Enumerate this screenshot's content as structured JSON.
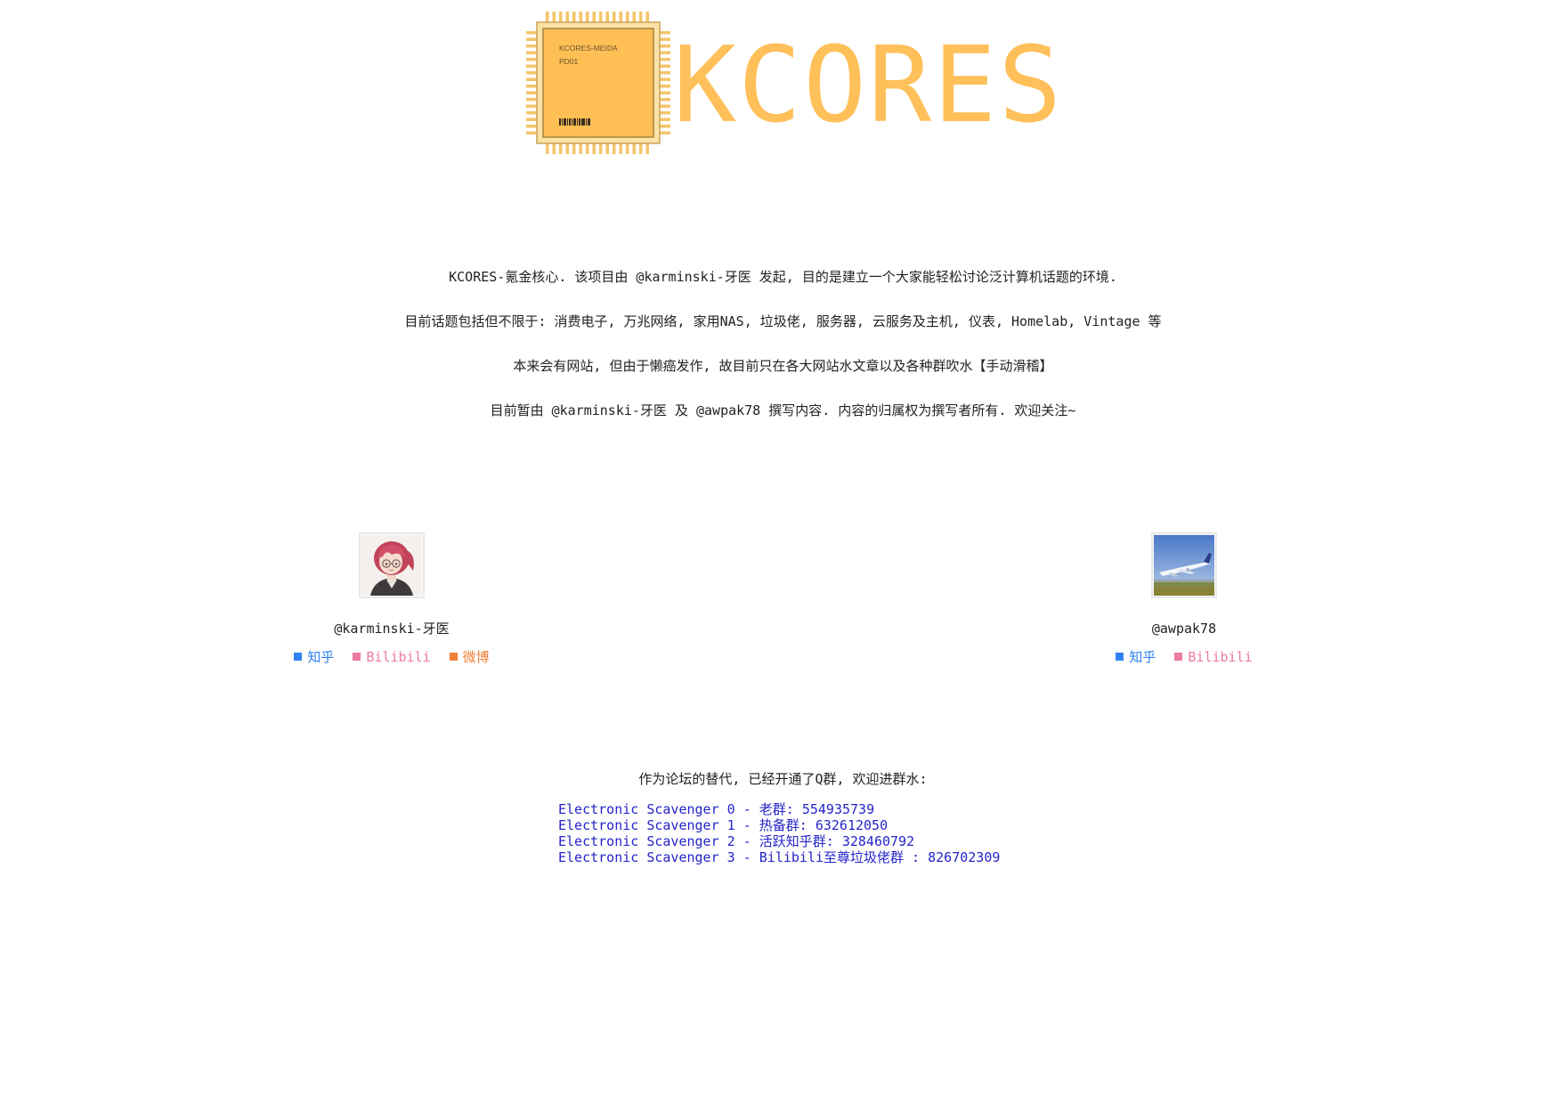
{
  "header": {
    "brand": "KCORES",
    "chip_line1": "KCORES-MEIDA",
    "chip_line2": "PD01",
    "colors": {
      "brand": "#ffc05a",
      "chip_body": "#ffbf55",
      "chip_border": "#a8843c"
    }
  },
  "intro": {
    "lines": [
      "KCORES-氪金核心. 该项目由 @karminski-牙医 发起, 目的是建立一个大家能轻松讨论泛计算机话题的环境.",
      "目前话题包括但不限于: 消费电子, 万兆网络, 家用NAS, 垃圾佬, 服务器, 云服务及主机, 仪表, Homelab, Vintage 等",
      "本来会有网站, 但由于懒癌发作, 故目前只在各大网站水文章以及各种群吹水【手动滑稽】",
      "目前暂由 @karminski-牙医 及 @awpak78 撰写内容. 内容的归属权为撰写者所有. 欢迎关注~"
    ]
  },
  "authors": [
    {
      "handle": "@karminski-牙医",
      "avatar_icon": "anime-girl-avatar",
      "links": [
        {
          "label": "知乎",
          "color": "#2f82f2"
        },
        {
          "label": "Bilibili",
          "color": "#ec7aa3"
        },
        {
          "label": "微博",
          "color": "#f08037"
        }
      ]
    },
    {
      "handle": "@awpak78",
      "avatar_icon": "airplane-avatar",
      "links": [
        {
          "label": "知乎",
          "color": "#2f82f2"
        },
        {
          "label": "Bilibili",
          "color": "#ec7aa3"
        }
      ]
    }
  ],
  "groups": {
    "title": "作为论坛的替代, 已经开通了Q群, 欢迎进群水:",
    "items": [
      "Electronic Scavenger 0 - 老群: 554935739",
      "Electronic Scavenger 1 - 热备群: 632612050",
      "Electronic Scavenger 2 - 活跃知乎群: 328460792",
      "Electronic Scavenger 3 - Bilibili至尊垃圾佬群 : 826702309"
    ],
    "color": "#2424c8"
  }
}
